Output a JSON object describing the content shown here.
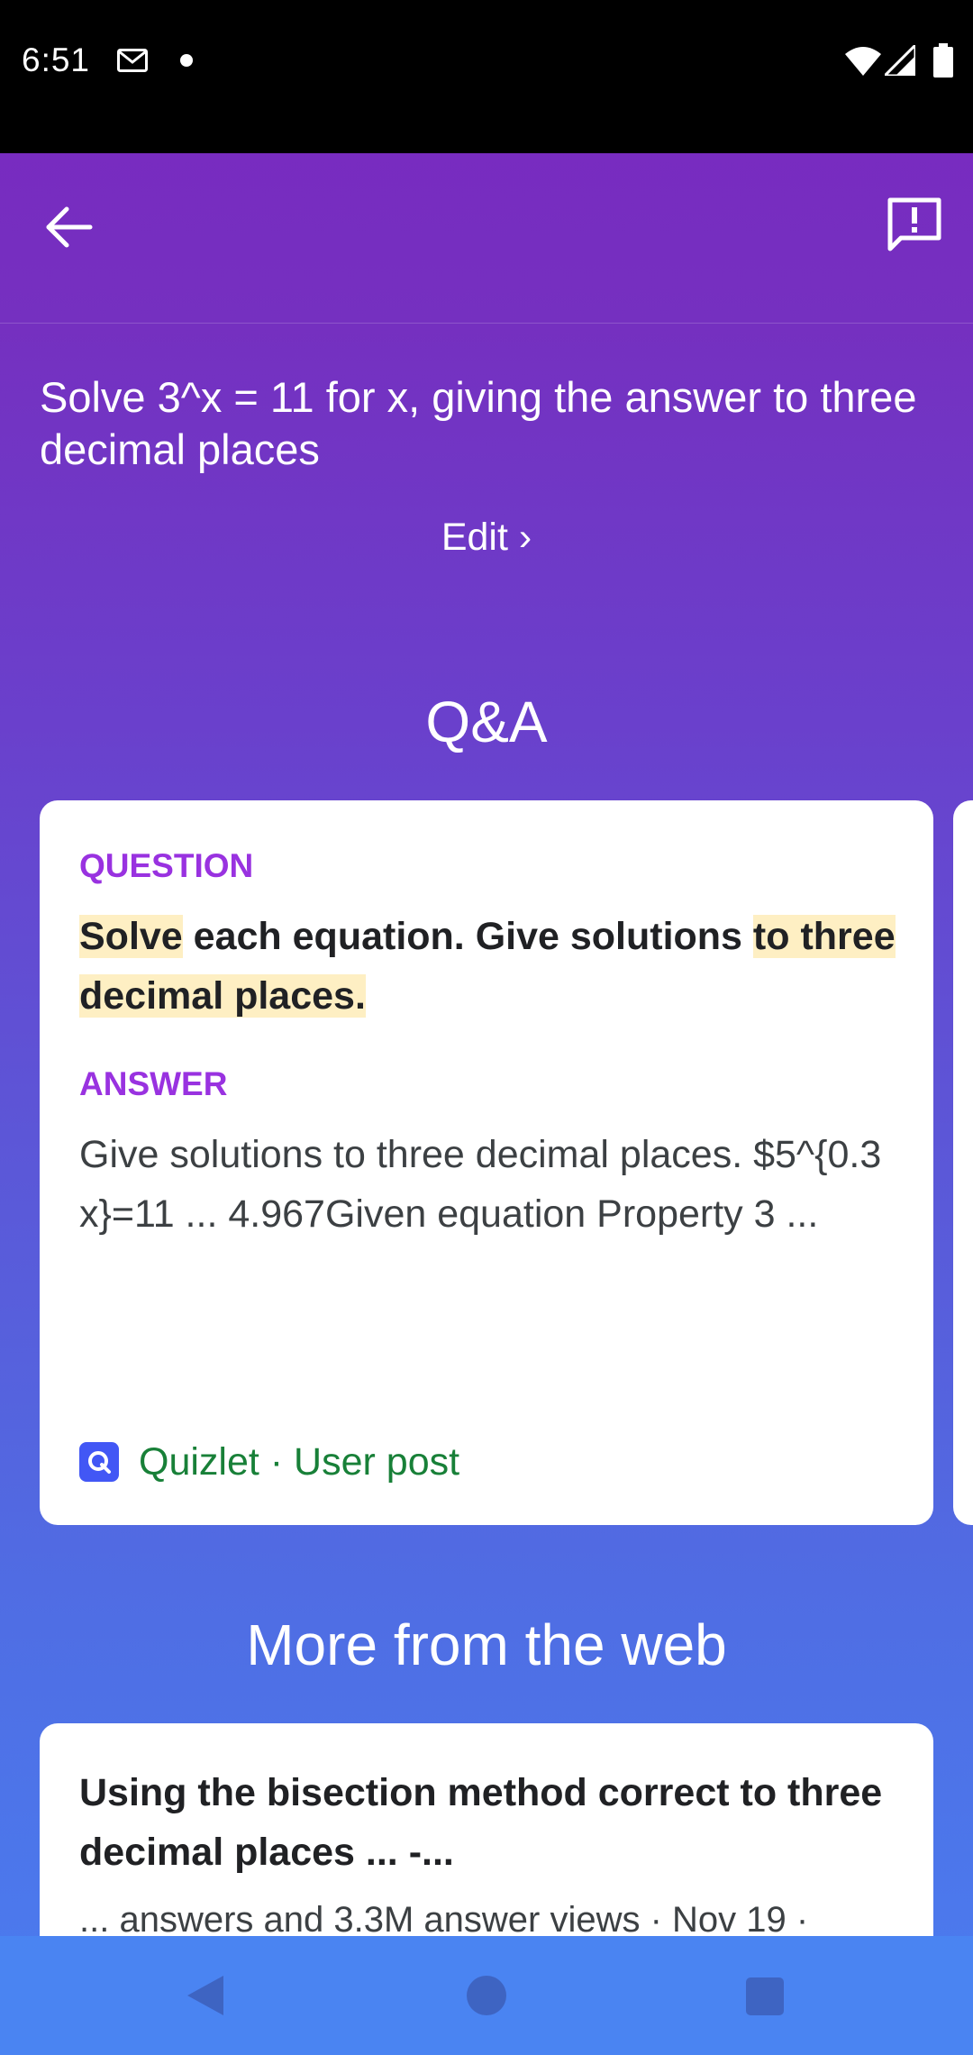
{
  "status_bar": {
    "time": "6:51",
    "icons": [
      "gmail-icon",
      "notification-dot-icon",
      "wifi-icon",
      "signal-icon",
      "battery-icon"
    ]
  },
  "app_bar": {
    "back_icon": "arrow-back-icon",
    "feedback_icon": "feedback-icon"
  },
  "query": {
    "text": "Solve 3^x = 11 for x, giving the answer to three decimal places",
    "edit_label": "Edit ›"
  },
  "qa_section": {
    "title": "Q&A",
    "card": {
      "question_label": "QUESTION",
      "question_parts": {
        "p1": "Solve",
        "p2": " each equation. Give solutions ",
        "p3": "to three",
        "p4": "decimal places."
      },
      "answer_label": "ANSWER",
      "answer_text": "Give solutions to three decimal places. $5^{0.3 x}=11 ... 4.967Given equation Property 3 ...",
      "source": "Quizlet · User post",
      "source_icon": "quizlet-icon"
    }
  },
  "web_section": {
    "title": "More from the web",
    "card": {
      "title": "Using the bisection method correct to three decimal places ... -...",
      "meta": "... answers and 3.3M answer views · Nov 19 ·"
    }
  },
  "colors": {
    "accent_purple": "#9932e0",
    "highlight": "#feefc3",
    "source_green": "#188038",
    "quizlet_blue": "#4257f5"
  },
  "nav_bar": {
    "icons": [
      "nav-back-icon",
      "nav-home-icon",
      "nav-recents-icon"
    ]
  }
}
